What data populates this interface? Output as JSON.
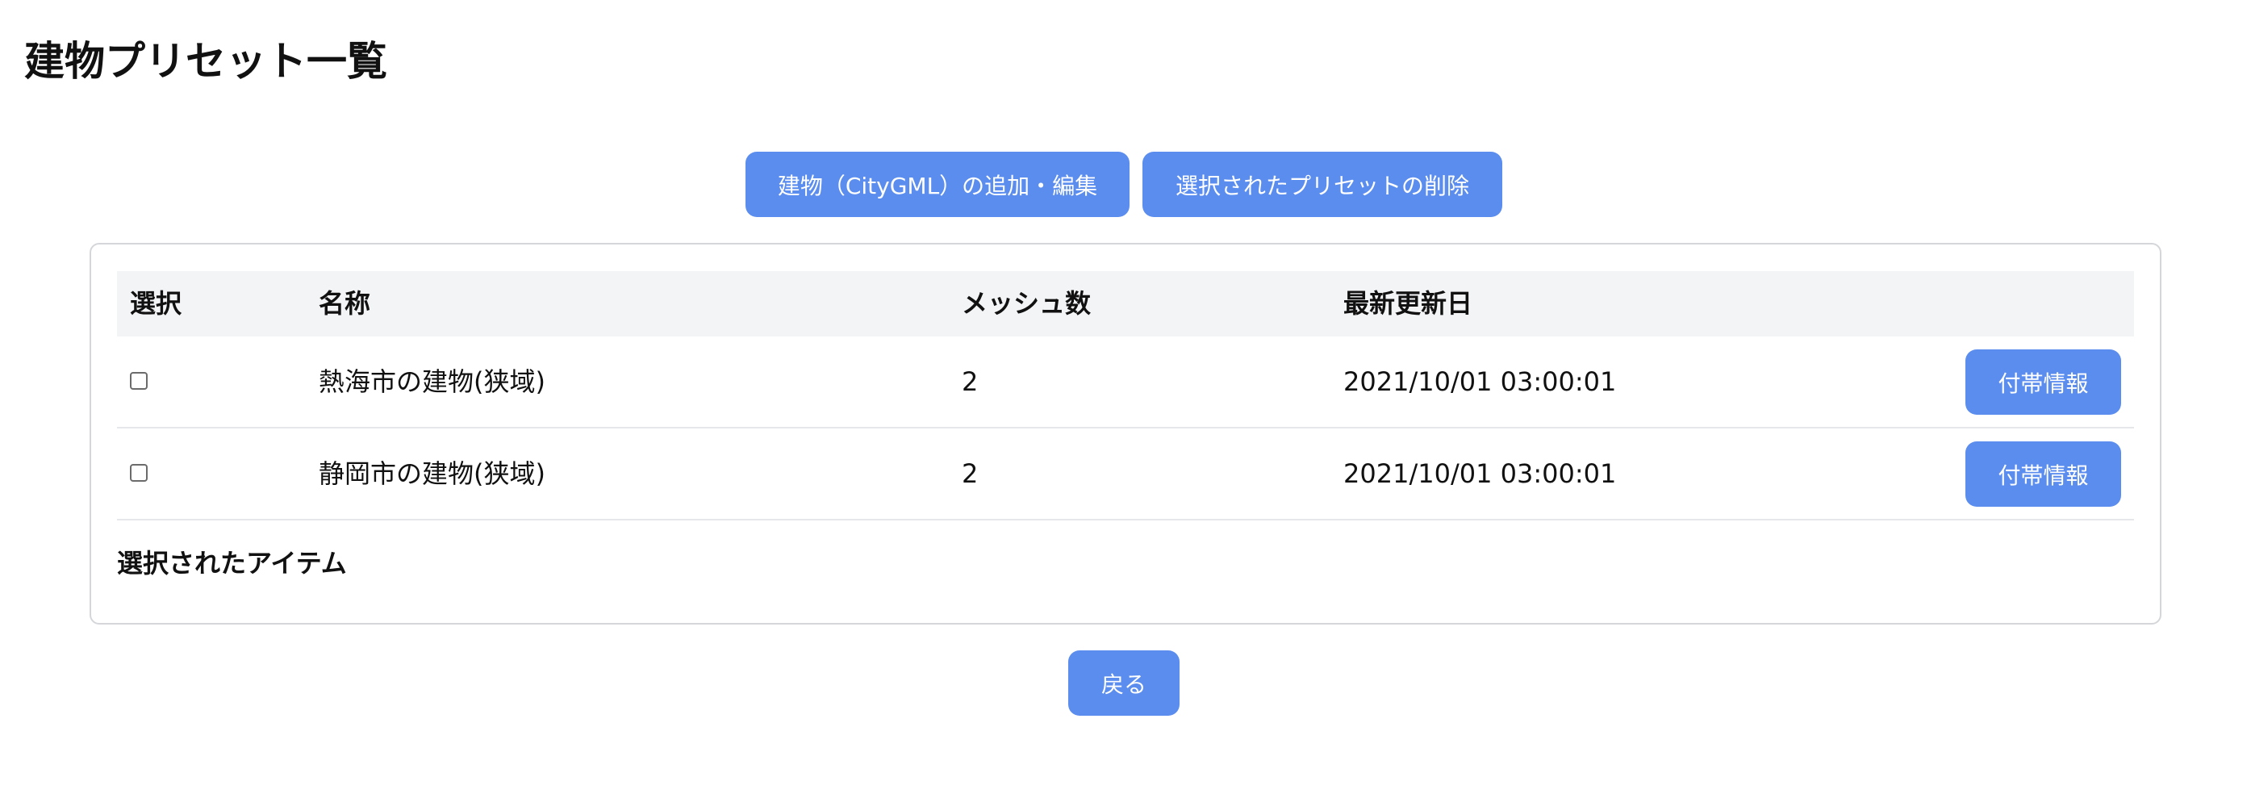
{
  "page": {
    "title": "建物プリセット一覧"
  },
  "toolbar": {
    "add_edit_label": "建物（CityGML）の追加・編集",
    "delete_selected_label": "選択されたプリセットの削除"
  },
  "table": {
    "columns": {
      "select": "選択",
      "name": "名称",
      "mesh_count": "メッシュ数",
      "updated": "最新更新日"
    },
    "rows": [
      {
        "checked": false,
        "name": "熱海市の建物(狭域)",
        "mesh_count": "2",
        "updated": "2021/10/01 03:00:01",
        "info_label": "付帯情報"
      },
      {
        "checked": false,
        "name": "静岡市の建物(狭域)",
        "mesh_count": "2",
        "updated": "2021/10/01 03:00:01",
        "info_label": "付帯情報"
      }
    ]
  },
  "selection": {
    "label": "選択されたアイテム"
  },
  "footer": {
    "back_label": "戻る"
  },
  "colors": {
    "accent": "#5b8def",
    "header_bg": "#f3f4f6",
    "border": "#d4d6da"
  }
}
